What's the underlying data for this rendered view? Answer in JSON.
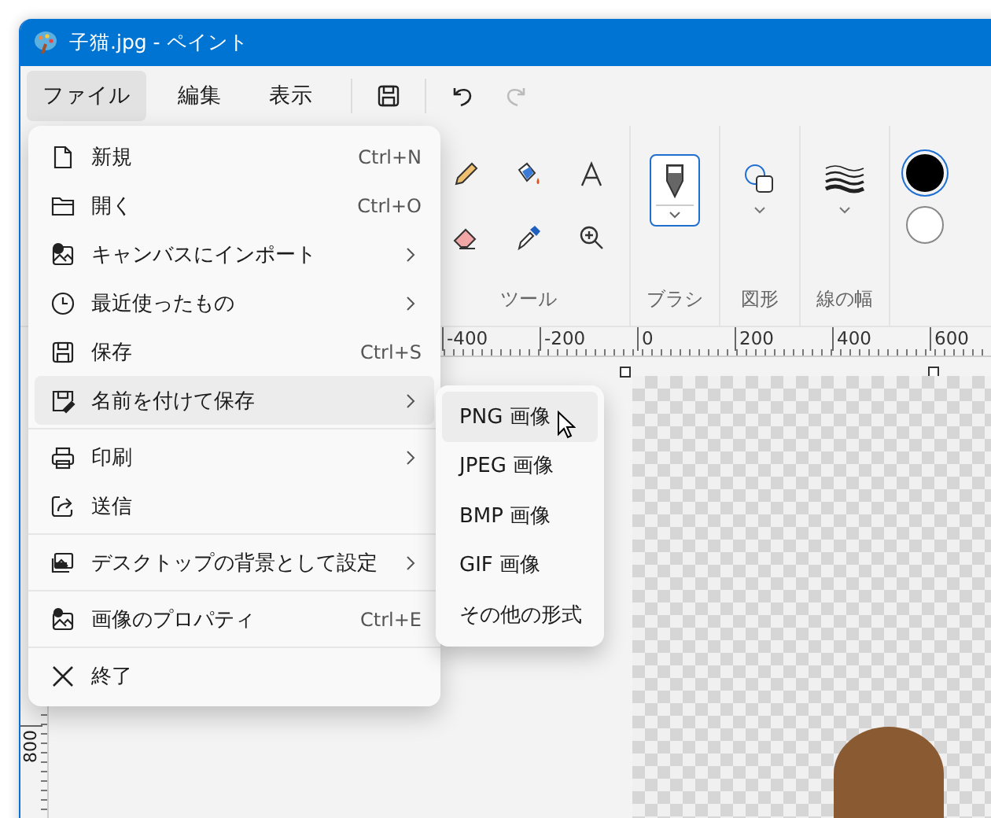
{
  "window": {
    "title": "子猫.jpg - ペイント"
  },
  "menubar": [
    {
      "label": "ファイル",
      "selected": true
    },
    {
      "label": "編集",
      "selected": false
    },
    {
      "label": "表示",
      "selected": false
    }
  ],
  "quick_toolbar": [
    {
      "kind": "save",
      "disabled": false
    },
    {
      "kind": "undo",
      "disabled": false
    },
    {
      "kind": "redo",
      "disabled": true
    }
  ],
  "ribbon": {
    "tools": {
      "label": "ツール",
      "items": [
        {
          "kind": "pencil"
        },
        {
          "kind": "fill"
        },
        {
          "kind": "text"
        },
        {
          "kind": "eraser"
        },
        {
          "kind": "picker"
        },
        {
          "kind": "magnifier"
        }
      ]
    },
    "brushes": {
      "label": "ブラシ",
      "selected": true
    },
    "shapes": {
      "label": "図形"
    },
    "line_width": {
      "label": "線の幅"
    },
    "colors": [
      {
        "color": "#000000",
        "selected": true
      },
      {
        "color": "#ffffff",
        "selected": false
      }
    ]
  },
  "ruler": {
    "h_labels": [
      "-400",
      "-200",
      "0",
      "200",
      "400",
      "600"
    ],
    "v_labels": [
      "800"
    ]
  },
  "file_menu": [
    [
      {
        "kind": "new",
        "label": "新規",
        "shortcut": "Ctrl+N",
        "submenu": false,
        "selected": false
      },
      {
        "kind": "open",
        "label": "開く",
        "shortcut": "Ctrl+O",
        "submenu": false,
        "selected": false
      },
      {
        "kind": "import",
        "label": "キャンバスにインポート",
        "submenu": true,
        "selected": false
      },
      {
        "kind": "recent",
        "label": "最近使ったもの",
        "submenu": true,
        "selected": false
      },
      {
        "kind": "save",
        "label": "保存",
        "shortcut": "Ctrl+S",
        "submenu": false,
        "selected": false
      },
      {
        "kind": "saveas",
        "label": "名前を付けて保存",
        "submenu": true,
        "selected": true
      }
    ],
    [
      {
        "kind": "print",
        "label": "印刷",
        "submenu": true,
        "selected": false
      },
      {
        "kind": "share",
        "label": "送信",
        "submenu": false,
        "selected": false
      }
    ],
    [
      {
        "kind": "desktop",
        "label": "デスクトップの背景として設定",
        "submenu": true,
        "selected": false
      }
    ],
    [
      {
        "kind": "properties",
        "label": "画像のプロパティ",
        "shortcut": "Ctrl+E",
        "submenu": false,
        "selected": false
      }
    ],
    [
      {
        "kind": "exit",
        "label": "終了",
        "submenu": false,
        "selected": false
      }
    ]
  ],
  "save_as_menu": [
    {
      "label": "PNG 画像",
      "selected": true
    },
    {
      "label": "JPEG 画像",
      "selected": false
    },
    {
      "label": "BMP 画像",
      "selected": false
    },
    {
      "label": "GIF 画像",
      "selected": false
    },
    {
      "label": "その他の形式",
      "selected": false
    }
  ]
}
